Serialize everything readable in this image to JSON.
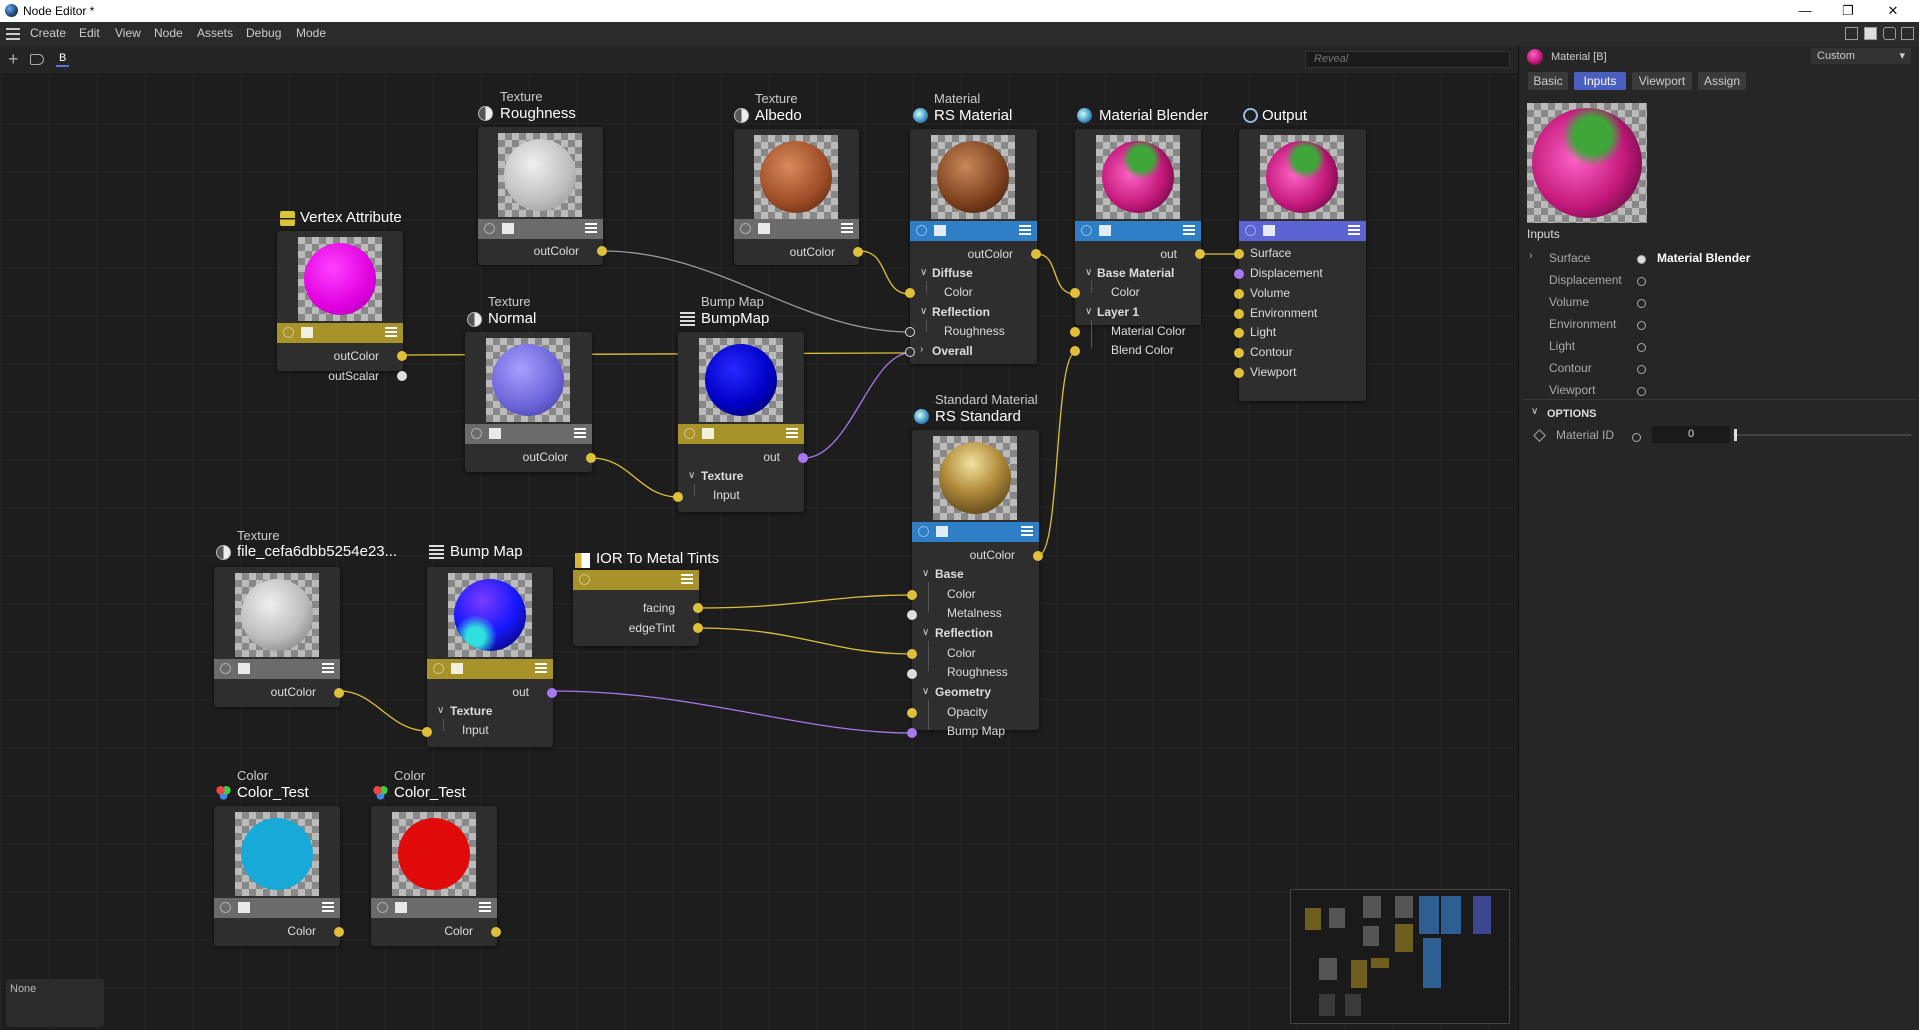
{
  "window": {
    "title": "Node Editor *"
  },
  "menu": {
    "items": [
      "Create",
      "Edit",
      "View",
      "Node",
      "Assets",
      "Debug",
      "Mode"
    ]
  },
  "toolbar": {
    "tab_label": "B",
    "search_placeholder": "Reveal"
  },
  "colors": {
    "port_yellow": "#e0c03a",
    "port_purple": "#a878f0",
    "header_texture": "#6b6b6b",
    "header_yellow": "#a8922a",
    "header_blue": "#2f7fc6",
    "header_output": "#5b64d2",
    "accent_tab": "#4a5fc0"
  },
  "nodes": {
    "roughness": {
      "type": "Texture",
      "name": "Roughness",
      "out": "outColor"
    },
    "albedo": {
      "type": "Texture",
      "name": "Albedo",
      "out": "outColor"
    },
    "rsmaterial": {
      "type": "Material",
      "name": "RS Material",
      "out": "outColor",
      "groups": [
        {
          "label": "Diffuse",
          "ports": [
            "Color"
          ]
        },
        {
          "label": "Reflection",
          "ports": [
            "Roughness"
          ]
        }
      ],
      "overall": "Overall"
    },
    "blender": {
      "name": "Material Blender",
      "out": "out",
      "groups": [
        {
          "label": "Base Material",
          "ports": [
            "Color"
          ]
        },
        {
          "label": "Layer 1",
          "ports": [
            "Material Color",
            "Blend Color"
          ]
        }
      ]
    },
    "output": {
      "name": "Output",
      "ports": [
        "Surface",
        "Displacement",
        "Volume",
        "Environment",
        "Light",
        "Contour",
        "Viewport"
      ]
    },
    "vertex": {
      "name": "Vertex Attribute",
      "outs": [
        "outColor",
        "outScalar"
      ]
    },
    "normal": {
      "type": "Texture",
      "name": "Normal",
      "out": "outColor"
    },
    "bumpmap1": {
      "type": "Bump Map",
      "name": "BumpMap",
      "out": "out",
      "group": "Texture",
      "input": "Input"
    },
    "standard": {
      "type": "Standard Material",
      "name": "RS Standard",
      "out": "outColor",
      "groups": [
        {
          "label": "Base",
          "ports": [
            "Color",
            "Metalness"
          ]
        },
        {
          "label": "Reflection",
          "ports": [
            "Color",
            "Roughness"
          ]
        },
        {
          "label": "Geometry",
          "ports": [
            "Opacity",
            "Bump Map"
          ]
        }
      ]
    },
    "file": {
      "type": "Texture",
      "name": "file_cefa6dbb5254e23...",
      "out": "outColor"
    },
    "bumpmap2": {
      "name": "Bump Map",
      "out": "out",
      "group": "Texture",
      "input": "Input"
    },
    "ior": {
      "name": "IOR To Metal Tints",
      "outs": [
        "facing",
        "edgeTint"
      ]
    },
    "color1": {
      "type": "Color",
      "name": "Color_Test",
      "out": "Color",
      "swatch": "#17a9d8"
    },
    "color2": {
      "type": "Color",
      "name": "Color_Test",
      "out": "Color",
      "swatch": "#e00a0a"
    }
  },
  "status": {
    "none_label": "None"
  },
  "panel": {
    "title": "Material [B]",
    "preset": "Custom",
    "tabs": [
      "Basic",
      "Inputs",
      "Viewport",
      "Assign"
    ],
    "active_tab": "Inputs",
    "inputs_header": "Inputs",
    "inputs": [
      {
        "label": "Surface",
        "value": "Material Blender"
      },
      {
        "label": "Displacement",
        "value": ""
      },
      {
        "label": "Volume",
        "value": ""
      },
      {
        "label": "Environment",
        "value": ""
      },
      {
        "label": "Light",
        "value": ""
      },
      {
        "label": "Contour",
        "value": ""
      },
      {
        "label": "Viewport",
        "value": ""
      }
    ],
    "options_header": "OPTIONS",
    "material_id_label": "Material ID",
    "material_id_value": "0"
  }
}
